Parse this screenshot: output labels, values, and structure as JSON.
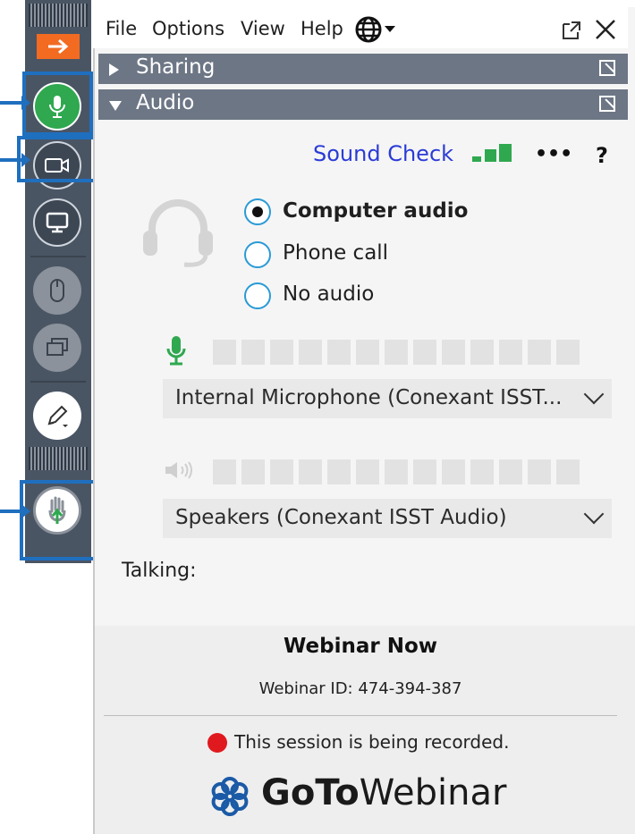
{
  "menu": {
    "file": "File",
    "options": "Options",
    "view": "View",
    "help": "Help"
  },
  "sections": {
    "sharing": "Sharing",
    "audio": "Audio"
  },
  "audio": {
    "sound_check": "Sound Check",
    "more": "•••",
    "help": "?",
    "options": [
      {
        "label": "Computer audio",
        "selected": true
      },
      {
        "label": "Phone call",
        "selected": false
      },
      {
        "label": "No audio",
        "selected": false
      }
    ],
    "microphone": "Internal Microphone (Conexant ISST...",
    "speakers": "Speakers (Conexant ISST Audio)",
    "talking_label": "Talking:"
  },
  "webinar": {
    "title": "Webinar Now",
    "id_line": "Webinar ID: 474-394-387",
    "recording_notice": "This session is being recorded.",
    "brand_goto": "GoTo",
    "brand_webinar": "Webinar"
  },
  "colors": {
    "toolbar_bg": "#4a5564",
    "section_bar": "#6d7685",
    "accent_green": "#2fa84f",
    "accent_orange": "#f26b21",
    "highlight_blue": "#1f6fbf",
    "link_blue": "#2a3bd6",
    "radio_blue": "#2a9ad6",
    "record_red": "#e0191e",
    "brand_blue": "#1b5aa6"
  },
  "icons": {
    "collapse": "arrow-right-icon",
    "mic": "microphone-icon",
    "camera": "camera-icon",
    "screen": "screen-share-icon",
    "mouse": "mouse-icon",
    "windows": "windows-icon",
    "draw": "pencil-icon",
    "hand": "raise-hand-icon",
    "globe": "globe-icon",
    "popout": "popout-icon",
    "close": "close-icon",
    "headset": "headset-icon",
    "speaker": "speaker-icon",
    "logo": "gotowebinar-logo-icon"
  }
}
